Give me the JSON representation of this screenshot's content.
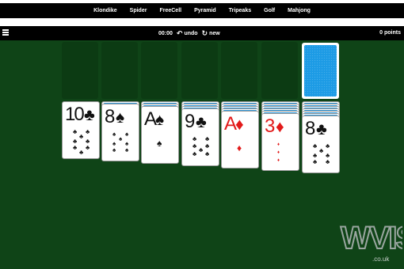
{
  "nav": {
    "items": [
      {
        "label": "Klondike"
      },
      {
        "label": "Spider"
      },
      {
        "label": "FreeCell"
      },
      {
        "label": "Pyramid"
      },
      {
        "label": "Tripeaks"
      },
      {
        "label": "Golf"
      },
      {
        "label": "Mahjong"
      }
    ]
  },
  "toolbar": {
    "menu_icon": "hamburger-menu-icon",
    "time": "00:00",
    "undo_icon": "undo-icon",
    "undo_label": "undo",
    "new_icon": "refresh-icon",
    "new_label": "new",
    "points": "0 points"
  },
  "stock": {
    "state": "face-down"
  },
  "tableau": [
    {
      "rank": "10",
      "suit": "clubs",
      "suit_symbol": "♣",
      "color": "black",
      "hidden_above": 0
    },
    {
      "rank": "8",
      "suit": "spades",
      "suit_symbol": "♠",
      "color": "black",
      "hidden_above": 1
    },
    {
      "rank": "A",
      "suit": "spades",
      "suit_symbol": "♠",
      "color": "black",
      "hidden_above": 2
    },
    {
      "rank": "9",
      "suit": "clubs",
      "suit_symbol": "♣",
      "color": "black",
      "hidden_above": 3
    },
    {
      "rank": "A",
      "suit": "diamonds",
      "suit_symbol": "♦",
      "color": "red",
      "hidden_above": 4
    },
    {
      "rank": "3",
      "suit": "diamonds",
      "suit_symbol": "♦",
      "color": "red",
      "hidden_above": 5
    },
    {
      "rank": "8",
      "suit": "clubs",
      "suit_symbol": "♣",
      "color": "black",
      "hidden_above": 6
    }
  ],
  "watermark": {
    "text": "WVIS",
    "subtext": ".co.uk"
  },
  "colors": {
    "felt": "#0f4417",
    "card_back": "#1d9be5",
    "red_suit": "#e21a1a"
  }
}
